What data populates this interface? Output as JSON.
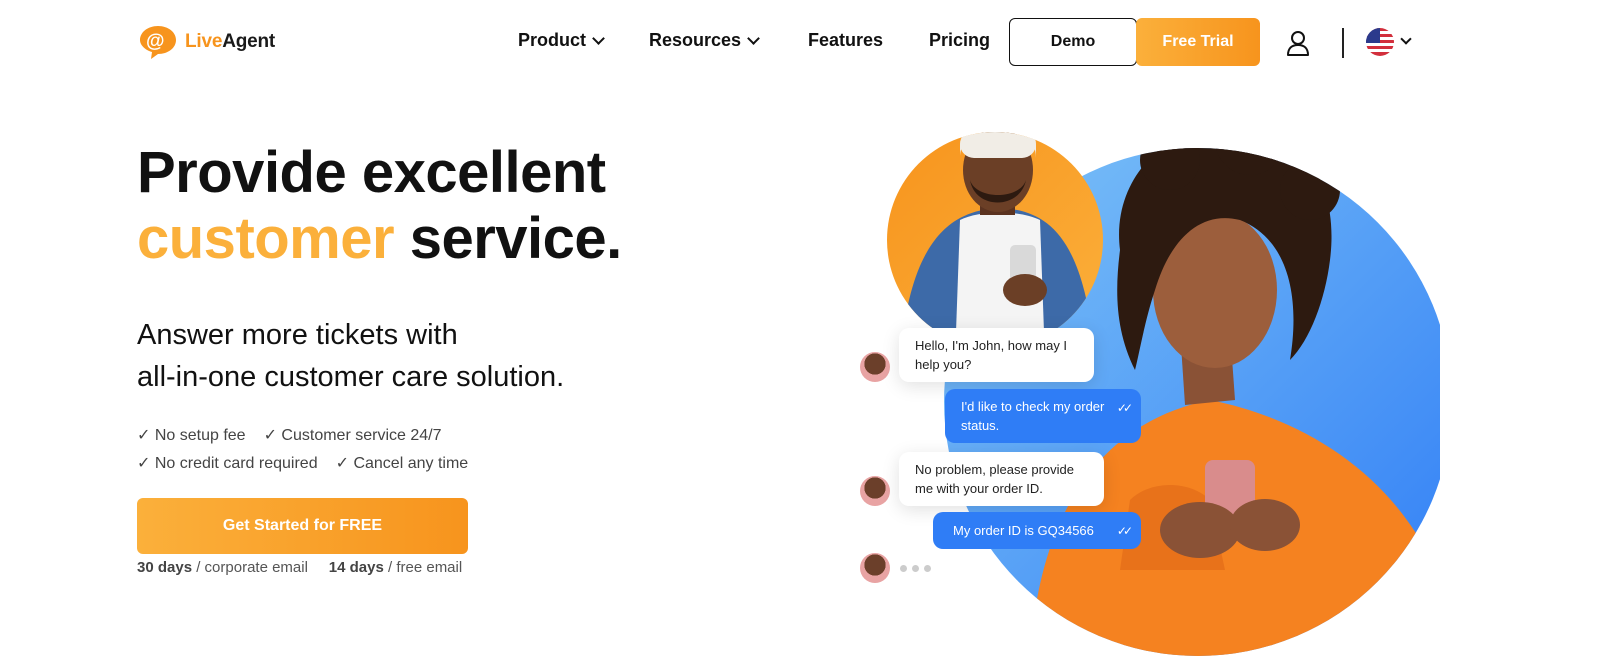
{
  "brand": {
    "name_part1": "Live",
    "name_part2": "Agent"
  },
  "nav": {
    "product": "Product",
    "resources": "Resources",
    "features": "Features",
    "pricing": "Pricing",
    "demo": "Demo",
    "free_trial": "Free Trial"
  },
  "hero": {
    "title_line1": "Provide excellent",
    "title_accent": "customer",
    "title_rest": " service.",
    "subtitle_line1": "Answer more tickets with",
    "subtitle_line2": "all-in-one customer care solution.",
    "checks": [
      "✓ No setup fee",
      "✓ Customer service 24/7",
      "✓ No credit card required",
      "✓ Cancel any time"
    ],
    "cta": "Get Started for FREE",
    "trial_days_1": "30 days",
    "trial_text_1": " / corporate email",
    "trial_days_2": "14 days",
    "trial_text_2": " / free email"
  },
  "chat": {
    "msg1": "Hello, I'm John, how may I help you?",
    "msg2": "I'd like to check my order status.",
    "msg3": "No problem, please provide me with your order ID.",
    "msg4": "My order ID is GQ34566"
  },
  "colors": {
    "accent": "#fbb03b",
    "accent_dark": "#f7941d",
    "chat_blue": "#2f7df6",
    "circle_blue": "#3a8ef6"
  }
}
